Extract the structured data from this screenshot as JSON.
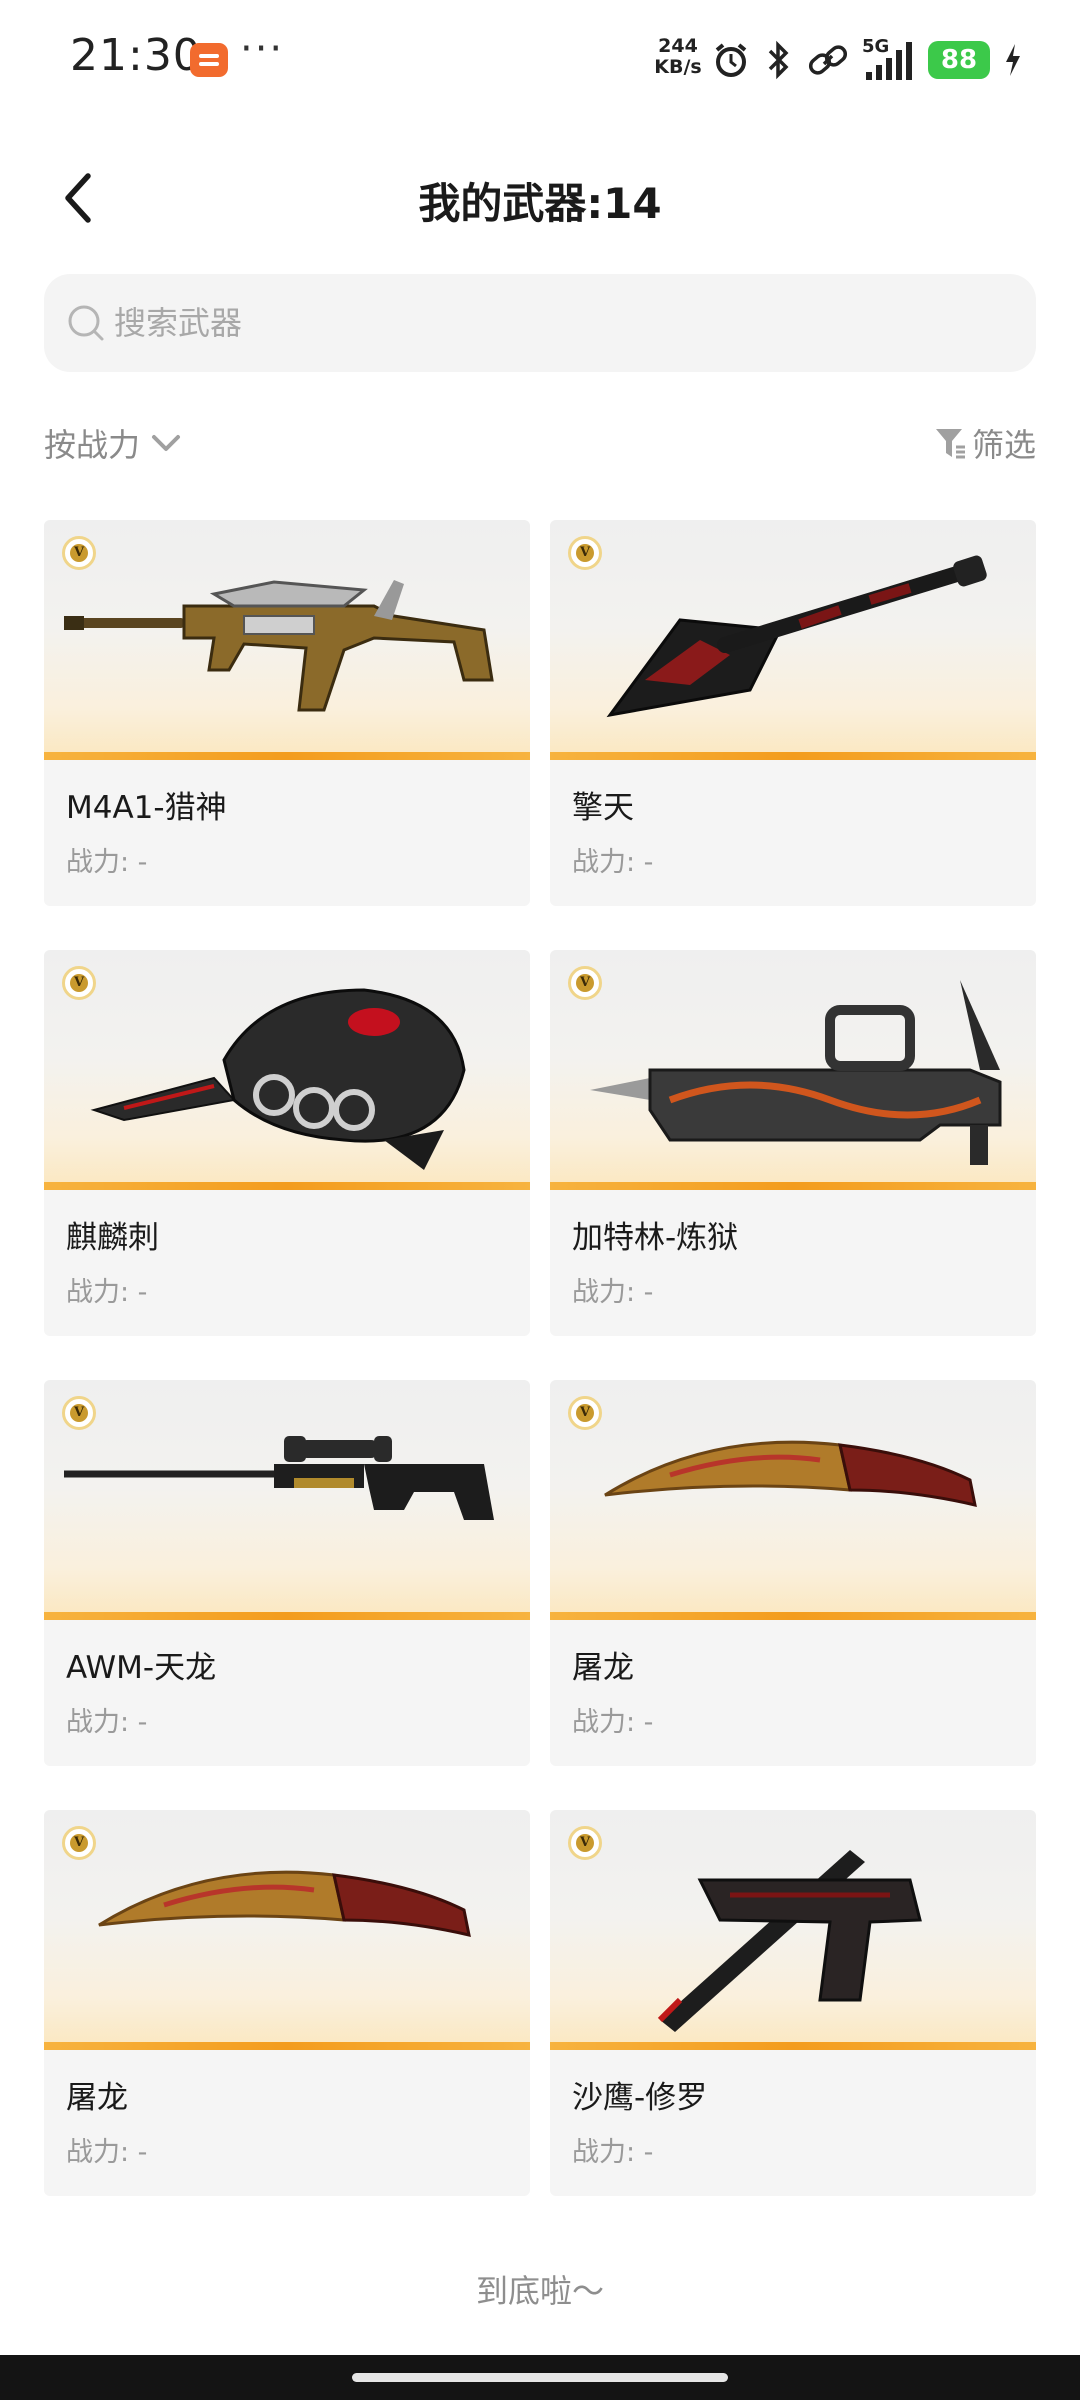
{
  "status_bar": {
    "time": "21:30",
    "more": "···",
    "speed_value": "244",
    "speed_unit": "KB/s",
    "network": "5G",
    "battery": "88"
  },
  "header": {
    "title": "我的武器:14"
  },
  "search": {
    "placeholder": "搜索武器",
    "value": ""
  },
  "sort": {
    "label": "按战力"
  },
  "filter": {
    "label": "筛选"
  },
  "badge_letter": "V",
  "weapons": [
    {
      "name": "M4A1-猎神",
      "power": "战力: -",
      "icon": "rifle-icon"
    },
    {
      "name": "擎天",
      "power": "战力: -",
      "icon": "shovel-icon"
    },
    {
      "name": "麒麟刺",
      "power": "战力: -",
      "icon": "knuckle-knife-icon"
    },
    {
      "name": "加特林-炼狱",
      "power": "战力: -",
      "icon": "gatling-icon"
    },
    {
      "name": "AWM-天龙",
      "power": "战力: -",
      "icon": "sniper-rifle-icon"
    },
    {
      "name": "屠龙",
      "power": "战力: -",
      "icon": "kukri-icon"
    },
    {
      "name": "屠龙",
      "power": "战力: -",
      "icon": "kukri-icon"
    },
    {
      "name": "沙鹰-修罗",
      "power": "战力: -",
      "icon": "pistol-knife-icon"
    }
  ],
  "footer": {
    "end_text": "到底啦～"
  },
  "colors": {
    "accent_orange": "#f39c1d",
    "card_bg": "#f5f5f5",
    "battery_green": "#3cc94a"
  }
}
